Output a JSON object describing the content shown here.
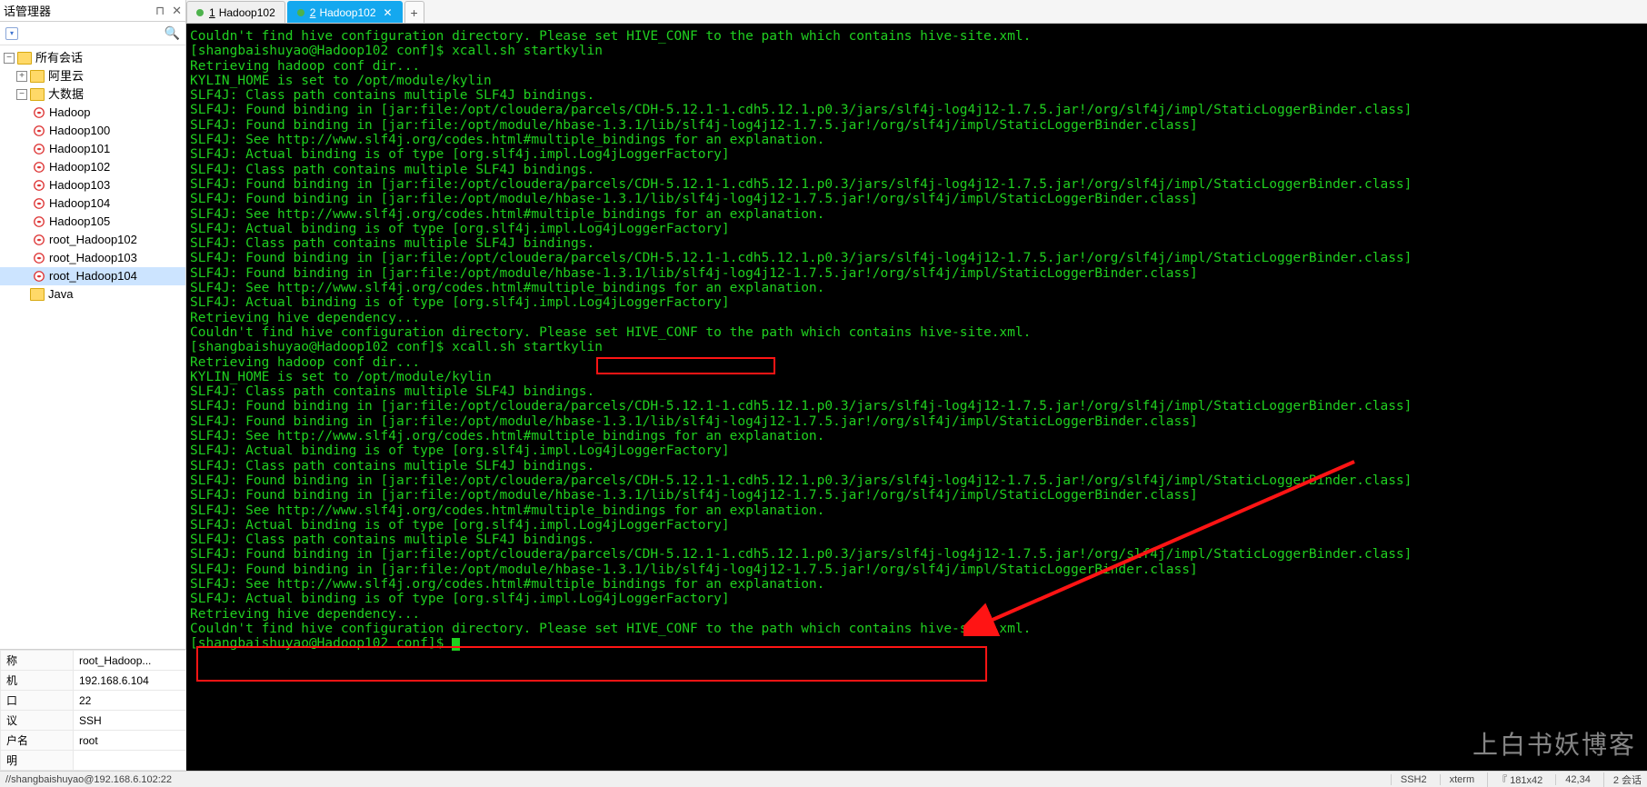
{
  "sidebar": {
    "title": "话管理器",
    "root": "所有会话",
    "group1": "阿里云",
    "group2": "大数据",
    "sessions": [
      "Hadoop",
      "Hadoop100",
      "Hadoop101",
      "Hadoop102",
      "Hadoop103",
      "Hadoop104",
      "Hadoop105",
      "root_Hadoop102",
      "root_Hadoop103",
      "root_Hadoop104"
    ],
    "java": "Java"
  },
  "props": {
    "rows": [
      [
        "称",
        "root_Hadoop..."
      ],
      [
        "机",
        "192.168.6.104"
      ],
      [
        "口",
        "22"
      ],
      [
        "议",
        "SSH"
      ],
      [
        "户名",
        "root"
      ],
      [
        "明",
        ""
      ]
    ]
  },
  "tabs": {
    "t1_num": "1",
    "t1_name": "Hadoop102",
    "t2_num": "2",
    "t2_name": "Hadoop102"
  },
  "terminal_lines": [
    "Couldn't find hive configuration directory. Please set HIVE_CONF to the path which contains hive-site.xml.",
    "[shangbaishuyao@Hadoop102 conf]$ xcall.sh startkylin",
    "Retrieving hadoop conf dir...",
    "KYLIN_HOME is set to /opt/module/kylin",
    "SLF4J: Class path contains multiple SLF4J bindings.",
    "SLF4J: Found binding in [jar:file:/opt/cloudera/parcels/CDH-5.12.1-1.cdh5.12.1.p0.3/jars/slf4j-log4j12-1.7.5.jar!/org/slf4j/impl/StaticLoggerBinder.class]",
    "SLF4J: Found binding in [jar:file:/opt/module/hbase-1.3.1/lib/slf4j-log4j12-1.7.5.jar!/org/slf4j/impl/StaticLoggerBinder.class]",
    "SLF4J: See http://www.slf4j.org/codes.html#multiple_bindings for an explanation.",
    "SLF4J: Actual binding is of type [org.slf4j.impl.Log4jLoggerFactory]",
    "SLF4J: Class path contains multiple SLF4J bindings.",
    "SLF4J: Found binding in [jar:file:/opt/cloudera/parcels/CDH-5.12.1-1.cdh5.12.1.p0.3/jars/slf4j-log4j12-1.7.5.jar!/org/slf4j/impl/StaticLoggerBinder.class]",
    "SLF4J: Found binding in [jar:file:/opt/module/hbase-1.3.1/lib/slf4j-log4j12-1.7.5.jar!/org/slf4j/impl/StaticLoggerBinder.class]",
    "SLF4J: See http://www.slf4j.org/codes.html#multiple_bindings for an explanation.",
    "SLF4J: Actual binding is of type [org.slf4j.impl.Log4jLoggerFactory]",
    "SLF4J: Class path contains multiple SLF4J bindings.",
    "SLF4J: Found binding in [jar:file:/opt/cloudera/parcels/CDH-5.12.1-1.cdh5.12.1.p0.3/jars/slf4j-log4j12-1.7.5.jar!/org/slf4j/impl/StaticLoggerBinder.class]",
    "SLF4J: Found binding in [jar:file:/opt/module/hbase-1.3.1/lib/slf4j-log4j12-1.7.5.jar!/org/slf4j/impl/StaticLoggerBinder.class]",
    "SLF4J: See http://www.slf4j.org/codes.html#multiple_bindings for an explanation.",
    "SLF4J: Actual binding is of type [org.slf4j.impl.Log4jLoggerFactory]",
    "Retrieving hive dependency...",
    "Couldn't find hive configuration directory. Please set HIVE_CONF to the path which contains hive-site.xml.",
    "[shangbaishuyao@Hadoop102 conf]$ xcall.sh startkylin",
    "Retrieving hadoop conf dir...",
    "KYLIN_HOME is set to /opt/module/kylin",
    "SLF4J: Class path contains multiple SLF4J bindings.",
    "SLF4J: Found binding in [jar:file:/opt/cloudera/parcels/CDH-5.12.1-1.cdh5.12.1.p0.3/jars/slf4j-log4j12-1.7.5.jar!/org/slf4j/impl/StaticLoggerBinder.class]",
    "SLF4J: Found binding in [jar:file:/opt/module/hbase-1.3.1/lib/slf4j-log4j12-1.7.5.jar!/org/slf4j/impl/StaticLoggerBinder.class]",
    "SLF4J: See http://www.slf4j.org/codes.html#multiple_bindings for an explanation.",
    "SLF4J: Actual binding is of type [org.slf4j.impl.Log4jLoggerFactory]",
    "SLF4J: Class path contains multiple SLF4J bindings.",
    "SLF4J: Found binding in [jar:file:/opt/cloudera/parcels/CDH-5.12.1-1.cdh5.12.1.p0.3/jars/slf4j-log4j12-1.7.5.jar!/org/slf4j/impl/StaticLoggerBinder.class]",
    "SLF4J: Found binding in [jar:file:/opt/module/hbase-1.3.1/lib/slf4j-log4j12-1.7.5.jar!/org/slf4j/impl/StaticLoggerBinder.class]",
    "SLF4J: See http://www.slf4j.org/codes.html#multiple_bindings for an explanation.",
    "SLF4J: Actual binding is of type [org.slf4j.impl.Log4jLoggerFactory]",
    "SLF4J: Class path contains multiple SLF4J bindings.",
    "SLF4J: Found binding in [jar:file:/opt/cloudera/parcels/CDH-5.12.1-1.cdh5.12.1.p0.3/jars/slf4j-log4j12-1.7.5.jar!/org/slf4j/impl/StaticLoggerBinder.class]",
    "SLF4J: Found binding in [jar:file:/opt/module/hbase-1.3.1/lib/slf4j-log4j12-1.7.5.jar!/org/slf4j/impl/StaticLoggerBinder.class]",
    "SLF4J: See http://www.slf4j.org/codes.html#multiple_bindings for an explanation.",
    "SLF4J: Actual binding is of type [org.slf4j.impl.Log4jLoggerFactory]",
    "Retrieving hive dependency...",
    "Couldn't find hive configuration directory. Please set HIVE_CONF to the path which contains hive-site.xml.",
    "[shangbaishuyao@Hadoop102 conf]$ "
  ],
  "status": {
    "left": "//shangbaishuyao@192.168.6.102:22",
    "s1": "SSH2",
    "s2": "xterm",
    "s3": "181x42",
    "s4": "42,34",
    "s5": "2 会话"
  },
  "watermark": "上白书妖博客"
}
